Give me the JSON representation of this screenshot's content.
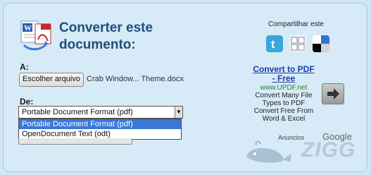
{
  "page": {
    "title_line1": "Converter este",
    "title_line2": "documento:"
  },
  "upload": {
    "label": "A:",
    "button_label": "Escolher arquivo",
    "file_name": "Crab Window... Theme.docx"
  },
  "format": {
    "label": "De:",
    "selected": "Portable Document Format (pdf)",
    "options": [
      "Portable Document Format (pdf)",
      "OpenDocument Text (odt)"
    ]
  },
  "share": {
    "label": "Compartilhar este",
    "icons": [
      "twitter-icon",
      "orkut-icon",
      "delicious-icon"
    ]
  },
  "ad": {
    "title_line1": "Convert to PDF",
    "title_line2": "- Free",
    "url": "www.UPDF.net",
    "body": [
      "Convert Many File",
      "Types to PDF",
      "Convert Free From",
      "Word & Excel"
    ],
    "attribution_prefix": "Anuncios",
    "attribution_brand": "Google"
  },
  "watermark": "ZIGG",
  "colors": {
    "background": "#cfe6f5",
    "title": "#1f4f7a",
    "ad_link": "#1a3ea8",
    "ad_url": "#2a7f2a",
    "selection": "#3a78d8"
  }
}
